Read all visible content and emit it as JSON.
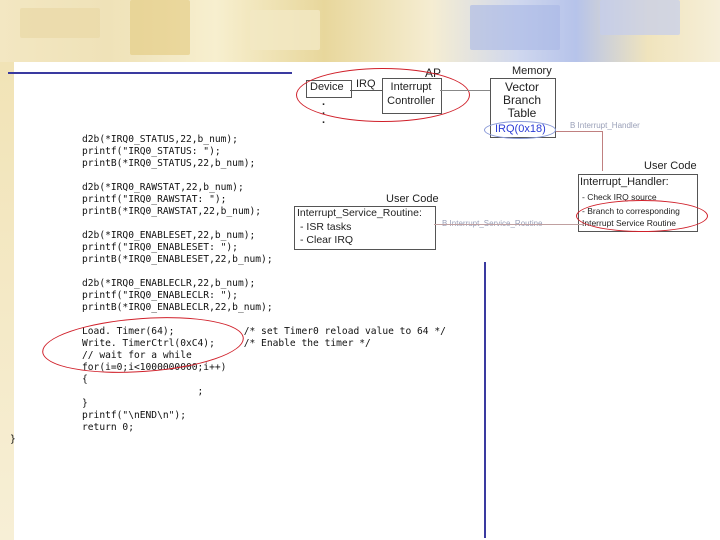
{
  "code": {
    "lines": [
      "d2b(*IRQ0_STATUS,22,b_num);",
      "printf(\"IRQ0_STATUS: \");",
      "printB(*IRQ0_STATUS,22,b_num);",
      "d2b(*IRQ0_RAWSTAT,22,b_num);",
      "printf(\"IRQ0_RAWSTAT: \");",
      "printB(*IRQ0_RAWSTAT,22,b_num);",
      "d2b(*IRQ0_ENABLESET,22,b_num);",
      "printf(\"IRQ0_ENABLESET: \");",
      "printB(*IRQ0_ENABLESET,22,b_num);",
      "d2b(*IRQ0_ENABLECLR,22,b_num);",
      "printf(\"IRQ0_ENABLECLR: \");",
      "printB(*IRQ0_ENABLECLR,22,b_num);",
      "Load. Timer(64);            /* set Timer0 reload value to 64 */",
      "Write. TimerCtrl(0xC4);     /* Enable the timer */",
      "// wait for a while",
      "for(i=0;i<1000000000;i++)",
      "{",
      "                    ;",
      "}",
      "printf(\"\\nEND\\n\");",
      "return 0;",
      "}"
    ]
  },
  "diagram": {
    "ap_label": "AP",
    "device_label": "Device",
    "irq_label": "IRQ",
    "interrupt_controller_label": "Interrupt Controller",
    "dots": ". . .",
    "memory_label": "Memory",
    "vector_table_label": "Vector Branch Table",
    "irq_address_label": "IRQ(0x18)",
    "branch_note": "B Interrupt_Handler",
    "user_code_right_title": "User Code",
    "interrupt_handler_label": "Interrupt_Handler:",
    "handler_steps": [
      "- Check IRQ source",
      "- Branch to corresponding",
      "  Interrupt Service Routine"
    ],
    "user_code_left_title": "User Code",
    "isr_label": "Interrupt_Service_Routine:",
    "isr_steps": [
      "- ISR tasks",
      "- Clear IRQ"
    ],
    "isr_faint_note": "B Interrupt_Service_Routine"
  },
  "colors": {
    "frame": "#3a3aa0",
    "highlight_ellipse": "#d0202a",
    "irq_highlight": "#2b3bd6"
  }
}
